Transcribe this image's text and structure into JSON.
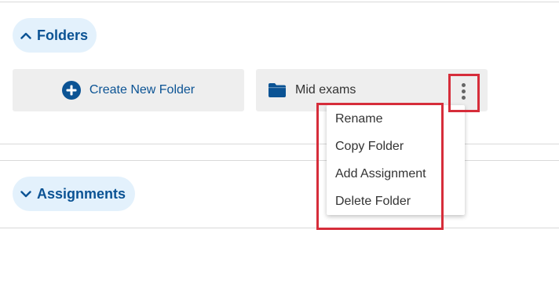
{
  "sections": {
    "folders": {
      "label": "Folders",
      "state": "expanded"
    },
    "assignments": {
      "label": "Assignments",
      "state": "collapsed"
    }
  },
  "create_folder": {
    "label": "Create New Folder",
    "icon": "plus-circle-icon"
  },
  "folder": {
    "name": "Mid exams",
    "icon": "folder-icon",
    "menu_icon": "more-vertical-icon"
  },
  "context_menu": {
    "items": [
      {
        "label": "Rename"
      },
      {
        "label": "Copy Folder"
      },
      {
        "label": "Add Assignment"
      },
      {
        "label": "Delete Folder"
      }
    ]
  },
  "colors": {
    "accent": "#0b5394",
    "pill_bg": "#e3f1fc",
    "card_bg": "#eeeeee",
    "highlight": "#d62d3a"
  }
}
